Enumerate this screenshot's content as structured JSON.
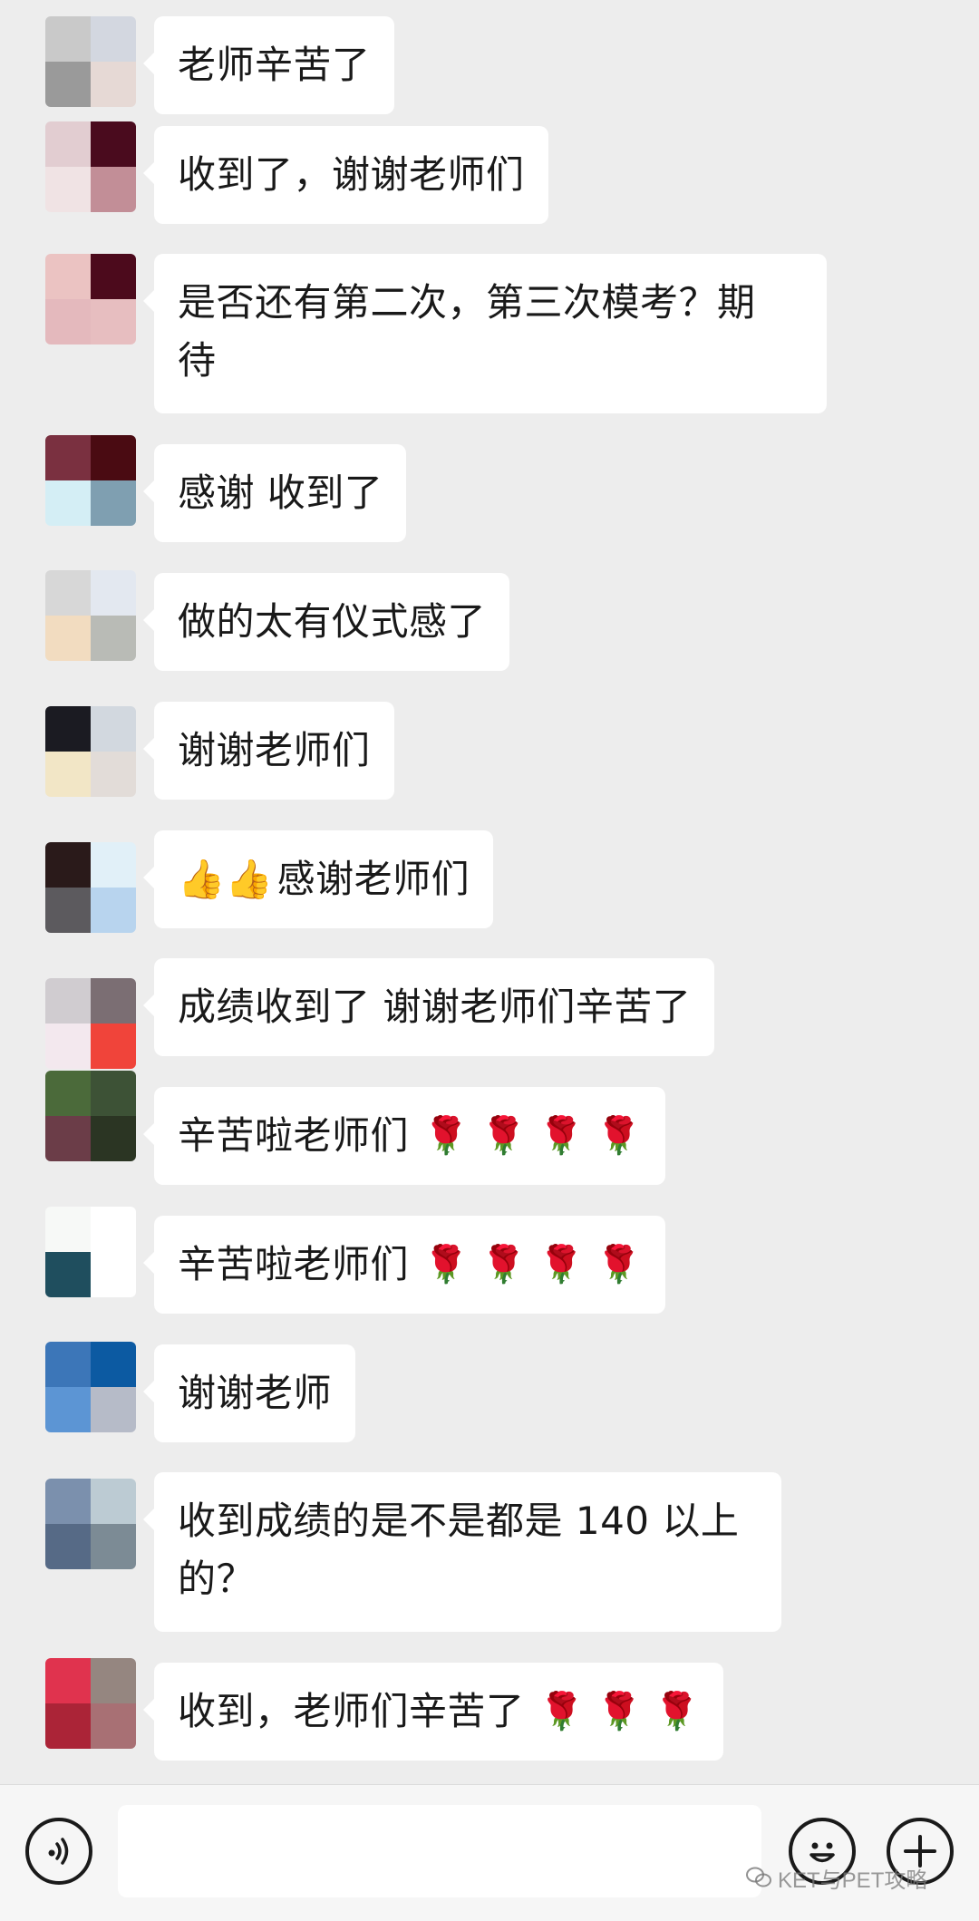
{
  "messages": [
    {
      "text": "老师辛苦了",
      "avatar": [
        "#c9c9c9",
        "#d3d7e0",
        "#9a9a9a",
        "#e6d9d5"
      ]
    },
    {
      "text": "收到了，谢谢老师们",
      "avatar": [
        "#e2cdd1",
        "#4a0b1e",
        "#f0e3e4",
        "#c28e97"
      ]
    },
    {
      "text": "是否还有第二次，第三次模考？期待",
      "lines": [
        "是否还有第二次，第三次模考？期",
        "待"
      ],
      "avatar": [
        "#ebc3c2",
        "#4c0a1c",
        "#e4b9bd",
        "#e7bec0"
      ]
    },
    {
      "text": "感谢 收到了",
      "avatar": [
        "#7a3040",
        "#4a0b12",
        "#d4eef5",
        "#7f9fb1"
      ]
    },
    {
      "text": "做的太有仪式感了",
      "avatar": [
        "#d7d7d7",
        "#e3e8f0",
        "#f2dcc0",
        "#b9bbb6"
      ]
    },
    {
      "text": "谢谢老师们",
      "avatar": [
        "#1b1b22",
        "#d2d8df",
        "#f2e6c6",
        "#e2dcd8"
      ]
    },
    {
      "text": "感谢老师们",
      "thumbs": "👍👍",
      "avatar": [
        "#2a1a1a",
        "#e1f0f8",
        "#5c5a5e",
        "#b8d4ee"
      ]
    },
    {
      "text": "成绩收到了 谢谢老师们辛苦了",
      "avatar": [
        "#d0ccd0",
        "#7b6e73",
        "#f3e8ee",
        "#f0443a"
      ]
    },
    {
      "text": "辛苦啦老师们",
      "roses": "🌹 🌹 🌹 🌹",
      "avatar": [
        "#4b6a3a",
        "#3d5236",
        "#6b3d48",
        "#2b3523"
      ]
    },
    {
      "text": "辛苦啦老师们",
      "roses": "🌹 🌹 🌹 🌹",
      "avatar": [
        "#f7f9f7",
        "#ffffff",
        "#1f4e5e",
        "#ffffff"
      ]
    },
    {
      "text": "谢谢老师",
      "avatar": [
        "#3c76b8",
        "#0c5aa2",
        "#5c95d4",
        "#b6bbc8"
      ]
    },
    {
      "text": "收到成绩的是不是都是140以上的？",
      "lines": [
        "收到成绩的是不是都是 140 以上",
        "的？"
      ],
      "avatar": [
        "#7b90ad",
        "#bccbd3",
        "#566a86",
        "#7c8b95"
      ]
    },
    {
      "text": "收到，老师们辛苦了",
      "roses": "🌹 🌹 🌹",
      "avatar": [
        "#e0334e",
        "#958680",
        "#ab2437",
        "#a87074"
      ]
    }
  ],
  "input_bar": {
    "voice_icon": "voice-icon",
    "emoji_icon": "smiley-icon",
    "plus_icon": "plus-icon",
    "watermark": "KET与PET攻略"
  }
}
